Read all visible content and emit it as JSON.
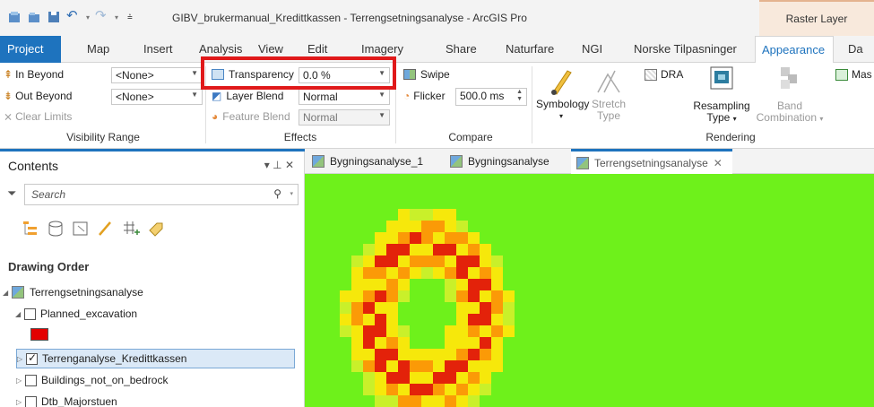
{
  "app": {
    "title": "GIBV_brukermanual_Kredittkassen - Terrengsetningsanalyse - ArcGIS Pro",
    "context_tab": "Raster Layer"
  },
  "ribbon_tabs": [
    "Project",
    "Map",
    "Insert",
    "Analysis",
    "View",
    "Edit",
    "Imagery",
    "Share",
    "Naturfare",
    "NGI",
    "Norske Tilpasninger",
    "Appearance",
    "Da"
  ],
  "visibility_range": {
    "in_beyond_label": "In Beyond",
    "in_beyond_value": "<None>",
    "out_beyond_label": "Out Beyond",
    "out_beyond_value": "<None>",
    "clear_limits": "Clear Limits",
    "group_label": "Visibility Range"
  },
  "effects": {
    "transparency_label": "Transparency",
    "transparency_value": "0.0 %",
    "layer_blend_label": "Layer Blend",
    "layer_blend_value": "Normal",
    "feature_blend_label": "Feature Blend",
    "feature_blend_value": "Normal",
    "group_label": "Effects"
  },
  "compare": {
    "swipe": "Swipe",
    "flicker_label": "Flicker",
    "flicker_value": "500.0 ms",
    "group_label": "Compare"
  },
  "rendering": {
    "symbology": "Symbology",
    "stretch_type_1": "Stretch",
    "stretch_type_2": "Type",
    "dra": "DRA",
    "resampling_1": "Resampling",
    "resampling_2": "Type",
    "band_1": "Band",
    "band_2": "Combination",
    "mask": "Mas",
    "group_label": "Rendering"
  },
  "contents": {
    "title": "Contents",
    "controls": "▾ ⊥ ✕",
    "search_placeholder": "Search",
    "drawing_order": "Drawing Order",
    "layers": [
      {
        "name": "Terrengsetningsanalyse"
      },
      {
        "name": "Planned_excavation",
        "swatch": "#e30000"
      },
      {
        "name": "Terrenganalyse_Kredittkassen",
        "checked": true,
        "selected": true
      },
      {
        "name": "Buildings_not_on_bedrock"
      },
      {
        "name": "Dtb_Majorstuen"
      }
    ]
  },
  "map_tabs": [
    "Bygningsanalyse_1",
    "Bygningsanalyse",
    "Terrengsetningsanalyse"
  ],
  "colors": {
    "accent": "#1e73be",
    "highlight": "#e0191a",
    "map_background": "#6ef11b",
    "raster_low": "#f6e80b",
    "raster_mid": "#fb9a07",
    "raster_high": "#e3220a"
  }
}
